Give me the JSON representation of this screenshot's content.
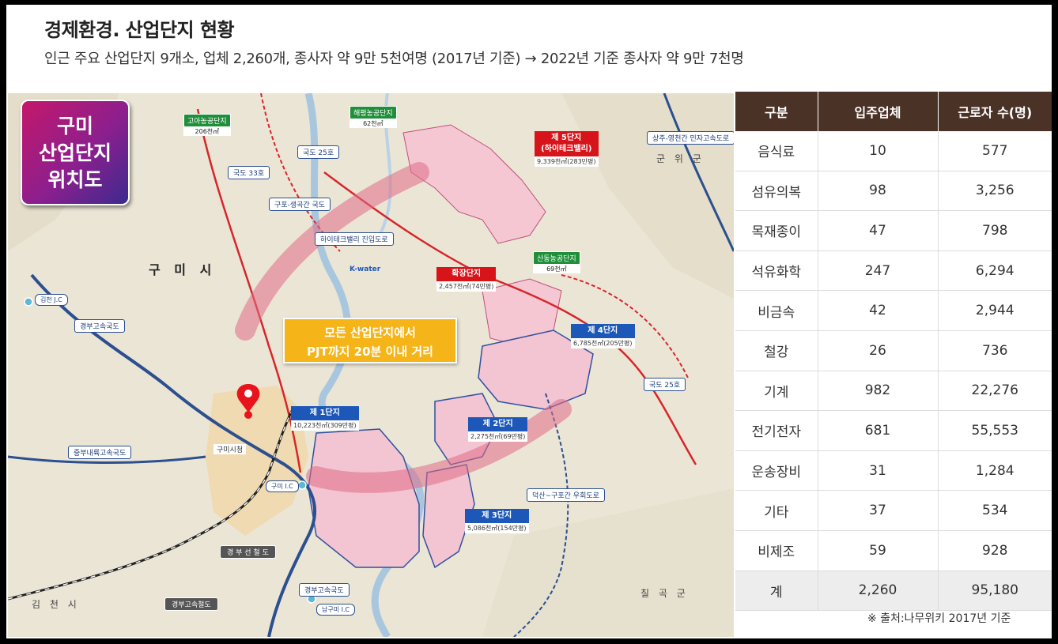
{
  "header": {
    "title": "경제환경. 산업단지 현황",
    "subtitle": "인근 주요 산업단지 9개소, 업체 2,260개, 종사자 약 9만 5천여명 (2017년 기준) → 2022년 기준 종사자 약 9만 7천명"
  },
  "map": {
    "badge_lines": [
      "구미",
      "산업단지",
      "위치도"
    ],
    "callout_lines": [
      "모든 산업단지에서",
      "PJT까지 20분 이내 거리"
    ],
    "cities": {
      "gumi": "구 미 시",
      "gimcheon": "김 천 시",
      "gunwi": "군 위 군",
      "chilgok": "칠 곡 군"
    },
    "roads": {
      "r25_top": "국도 25호",
      "r33": "국도 33호",
      "gugo": "구포-생곡간 국도",
      "hitech": "하이테크밸리 진입도로",
      "gyeongbu_exp_upper": "경부고속국도",
      "jungbu": "중부내륙고속국도",
      "gyeongbu_rail": "경 부 선 철 도",
      "gyeongbu_exp_lower": "경부고속국도",
      "gyeongbu_exp_lower2": "경부고속철도",
      "r25_right": "국도 25호",
      "sangju": "상주-영천간 민자고속도로",
      "bypass": "덕산~구포간 우회도로"
    },
    "junctions": {
      "gimcheon_jc": "김천 J.C",
      "gumi_ic": "구미 I.C",
      "namgumi_ic": "남구미 I.C"
    },
    "farm_complexes": [
      {
        "name": "고아농공단지",
        "area": "206천㎡"
      },
      {
        "name": "해평농공단지",
        "area": "62천㎡"
      },
      {
        "name": "산동농공단지",
        "area": "69천㎡"
      }
    ],
    "complexes": {
      "c5": {
        "name1": "제 5단지",
        "name2": "(하이테크밸리)",
        "area": "9,339천㎡(283만평)"
      },
      "exp": {
        "name1": "확장단지",
        "area": "2,457천㎡(74만평)"
      },
      "c4": {
        "name1": "제 4단지",
        "area": "6,785천㎡(205만평)"
      },
      "c1": {
        "name1": "제 1단지",
        "area": "10,223천㎡(309만평)"
      },
      "c2": {
        "name1": "제 2단지",
        "area": "2,275천㎡(69만평)"
      },
      "c3": {
        "name1": "제 3단지",
        "area": "5,086천㎡(154만평)"
      }
    },
    "brands": {
      "kwater": "K-water",
      "gumi_city": "구미시청"
    },
    "colors": {
      "pin": "#e8141b",
      "zone": "#f4c7d3",
      "arc": "#e06b87"
    }
  },
  "table": {
    "headers": [
      "구분",
      "입주업체",
      "근로자 수(명)"
    ],
    "rows": [
      [
        "음식료",
        "10",
        "577"
      ],
      [
        "섬유의복",
        "98",
        "3,256"
      ],
      [
        "목재종이",
        "47",
        "798"
      ],
      [
        "석유화학",
        "247",
        "6,294"
      ],
      [
        "비금속",
        "42",
        "2,944"
      ],
      [
        "철강",
        "26",
        "736"
      ],
      [
        "기계",
        "982",
        "22,276"
      ],
      [
        "전기전자",
        "681",
        "55,553"
      ],
      [
        "운송장비",
        "31",
        "1,284"
      ],
      [
        "기타",
        "37",
        "534"
      ],
      [
        "비제조",
        "59",
        "928"
      ]
    ],
    "total": [
      "계",
      "2,260",
      "95,180"
    ],
    "header_color": "#4a3227"
  },
  "source": "※ 출처:나무위키 2017년 기준"
}
